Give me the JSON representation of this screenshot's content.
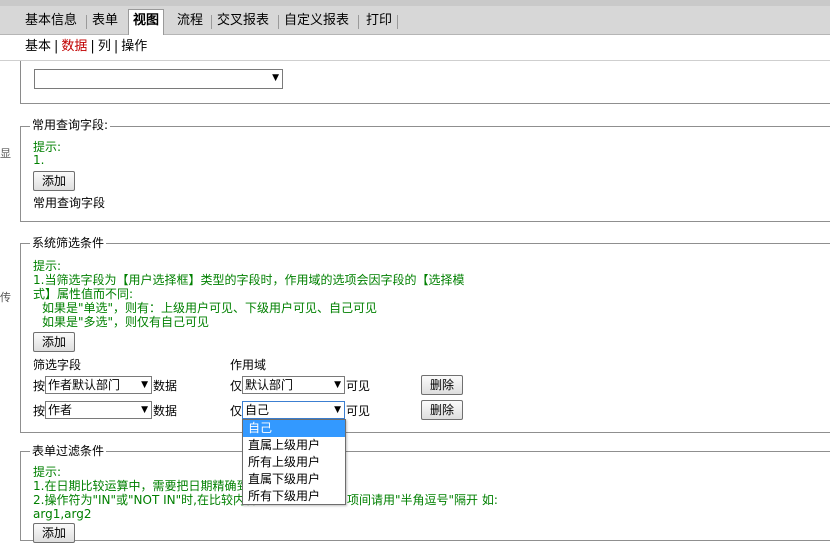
{
  "tabs": [
    "基本信息",
    "表单",
    "视图",
    "流程",
    "交叉报表",
    "自定义报表",
    "打印"
  ],
  "active_tab": "视图",
  "subnav": {
    "items": [
      "基本",
      "数据",
      "列",
      "操作"
    ],
    "separator": "|",
    "selected": "数据"
  },
  "edge_chars": [
    "显",
    "传"
  ],
  "common_query": {
    "legend": "常用查询字段",
    "hint_label": "提示:",
    "hints": [
      "1."
    ],
    "add_label": "添加",
    "footer_label": "常用查询字段"
  },
  "system_filter": {
    "legend": "系统筛选条件",
    "hint_label": "提示:",
    "hint_line1": "1.当筛选字段为【用户选择框】类型的字段时，作用域的选项会因字段的【选择模",
    "hint_line2": "式】属性值而不同:",
    "hint_line3": "如果是\"单选\"，则有：上级用户可见、下级用户可见、自己可见",
    "hint_line4": "如果是\"多选\"，则仅有自己可见",
    "add_label": "添加",
    "col_field": "筛选字段",
    "col_scope": "作用域",
    "rows": [
      {
        "prefix": "按",
        "field": "作者默认部门",
        "data_label": "数据",
        "scope_prefix": "仅",
        "scope": "默认部门",
        "visible_label": "可见",
        "delete_label": "删除"
      },
      {
        "prefix": "按",
        "field": "作者",
        "data_label": "数据",
        "scope_prefix": "仅",
        "scope": "自己",
        "visible_label": "可见",
        "delete_label": "删除"
      }
    ],
    "dropdown_options": [
      "自己",
      "直属上级用户",
      "所有上级用户",
      "直属下级用户",
      "所有下级用户"
    ],
    "highlighted_option": "自己"
  },
  "form_filter": {
    "legend": "表单过滤条件",
    "hint_label": "提示:",
    "hint_line1": "1.在日期比较运算中，需要把日期精确到",
    "hint_line2": "2.操作符为\"IN\"或\"NOT IN\"时,在比较内容",
    "hint_line2_tail": "项间请用\"半角逗号\"隔开 如:",
    "hint_line3": "arg1,arg2",
    "add_label": "添加"
  }
}
